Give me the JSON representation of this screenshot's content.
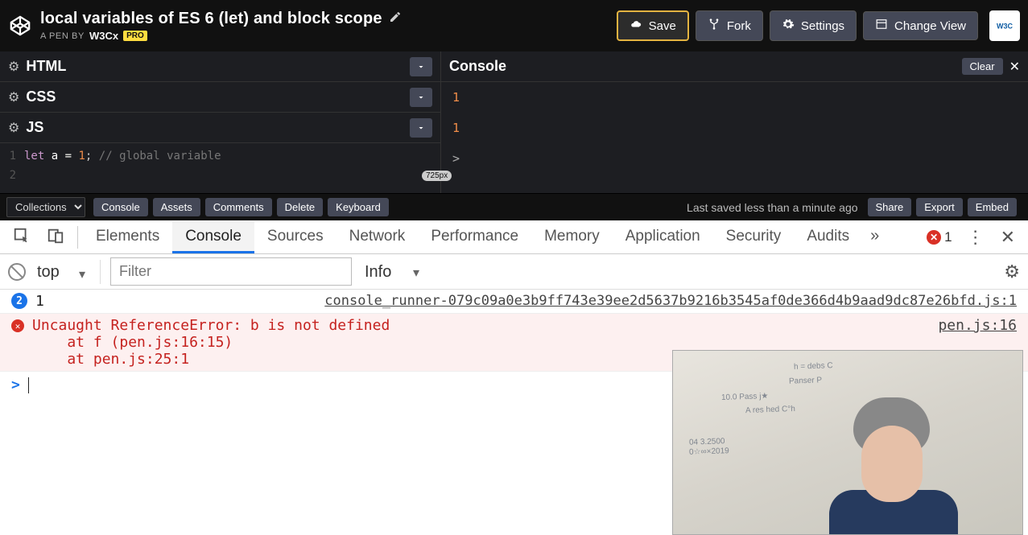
{
  "header": {
    "title": "local variables of ES 6 (let) and block scope",
    "subtitle_prefix": "A PEN BY",
    "brand": "W3Cx",
    "pro_badge": "PRO",
    "actions": {
      "save": "Save",
      "fork": "Fork",
      "settings": "Settings",
      "change_view": "Change View"
    }
  },
  "panels": {
    "html": "HTML",
    "css": "CSS",
    "js": "JS"
  },
  "editor": {
    "line1": {
      "kw": "let",
      "var": "a",
      "op": "=",
      "num": "1",
      "punc": ";",
      "cmt": "// global variable"
    },
    "line_numbers": [
      "1",
      "2"
    ]
  },
  "codepen_console": {
    "title": "Console",
    "clear": "Clear",
    "lines": [
      "1",
      "1"
    ],
    "prompt": ">",
    "pixel_label": "725px"
  },
  "footer": {
    "collections": "Collections",
    "buttons": {
      "console": "Console",
      "assets": "Assets",
      "comments": "Comments",
      "delete": "Delete",
      "keyboard": "Keyboard"
    },
    "saved": "Last saved less than a minute ago",
    "right": {
      "share": "Share",
      "export": "Export",
      "embed": "Embed"
    }
  },
  "devtools": {
    "tabs": {
      "elements": "Elements",
      "console": "Console",
      "sources": "Sources",
      "network": "Network",
      "performance": "Performance",
      "memory": "Memory",
      "application": "Application",
      "security": "Security",
      "audits": "Audits"
    },
    "error_count": "1",
    "toolbar": {
      "context": "top",
      "filter_placeholder": "Filter",
      "level": "Info"
    },
    "log1": {
      "badge": "2",
      "text": "1",
      "source": "console_runner-079c09a0e3b9ff743e39ee2d5637b9216b3545af0de366d4b9aad9dc87e26bfd.js:1"
    },
    "error": {
      "text": "Uncaught ReferenceError: b is not defined\n    at f (pen.js:16:15)\n    at pen.js:25:1",
      "source": "pen.js:16"
    },
    "prompt": ">"
  }
}
